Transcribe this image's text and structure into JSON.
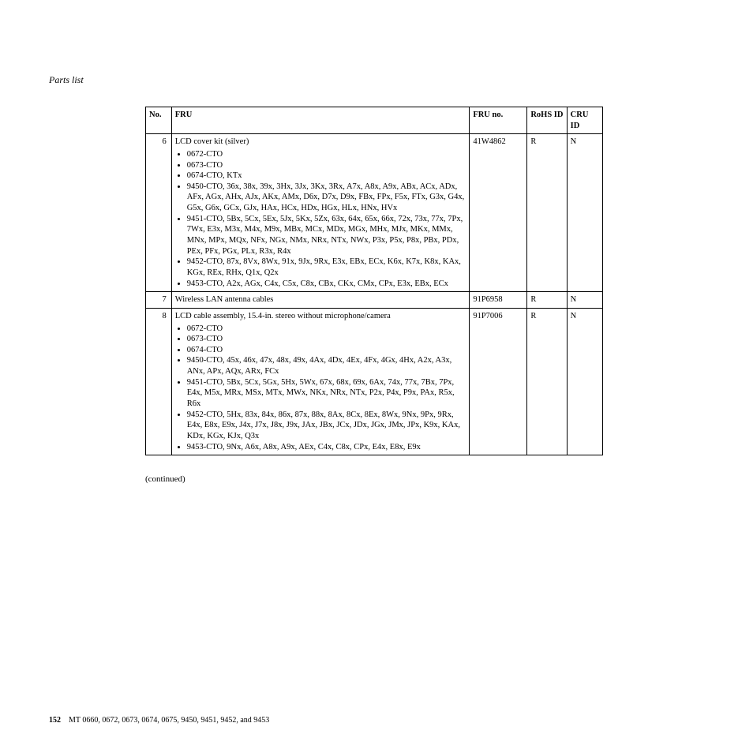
{
  "section_title": "Parts list",
  "headers": {
    "no": "No.",
    "fru": "FRU",
    "fru_no": "FRU no.",
    "rohs": "RoHS ID",
    "cru": "CRU ID"
  },
  "rows": [
    {
      "no": "6",
      "title": "LCD cover kit (silver)",
      "bullets": [
        "0672-CTO",
        "0673-CTO",
        "0674-CTO, KTx",
        "9450-CTO, 36x, 38x, 39x, 3Hx, 3Jx, 3Kx, 3Rx, A7x, A8x, A9x, ABx, ACx, ADx, AFx, AGx, AHx, AJx, AKx, AMx, D6x, D7x, D9x, FBx, FPx, F5x, FTx, G3x, G4x, G5x, G6x, GCx, GJx, HAx, HCx, HDx, HGx, HLx, HNx, HVx",
        "9451-CTO, 5Bx, 5Cx, 5Ex, 5Jx, 5Kx, 5Zx, 63x, 64x, 65x, 66x, 72x, 73x, 77x, 7Px, 7Wx, E3x, M3x, M4x, M9x, MBx, MCx, MDx, MGx, MHx, MJx, MKx, MMx, MNx, MPx, MQx, NFx, NGx, NMx, NRx, NTx, NWx, P3x, P5x, P8x, PBx, PDx, PEx, PFx, PGx, PLx, R3x, R4x",
        "9452-CTO, 87x, 8Vx, 8Wx, 91x, 9Jx, 9Rx, E3x, EBx, ECx, K6x, K7x, K8x, KAx, KGx, REx, RHx, Q1x, Q2x",
        "9453-CTO, A2x, AGx, C4x, C5x, C8x, CBx, CKx, CMx, CPx, E3x, EBx, ECx"
      ],
      "fru_no": "41W4862",
      "rohs": "R",
      "cru": "N"
    },
    {
      "no": "7",
      "title": "Wireless LAN antenna cables",
      "bullets": [],
      "fru_no": "91P6958",
      "rohs": "R",
      "cru": "N"
    },
    {
      "no": "8",
      "title": "LCD cable assembly, 15.4-in. stereo without microphone/camera",
      "bullets": [
        "0672-CTO",
        "0673-CTO",
        "0674-CTO",
        "9450-CTO, 45x, 46x, 47x, 48x, 49x, 4Ax, 4Dx, 4Ex, 4Fx, 4Gx, 4Hx, A2x, A3x, ANx, APx, AQx, ARx, FCx",
        "9451-CTO, 5Bx, 5Cx, 5Gx, 5Hx, 5Wx, 67x, 68x, 69x, 6Ax, 74x, 77x, 7Bx, 7Px, E4x, M5x, MRx, MSx, MTx, MWx, NKx, NRx, NTx, P2x, P4x, P9x, PAx, R5x, R6x",
        "9452-CTO, 5Hx, 83x, 84x, 86x, 87x, 88x, 8Ax, 8Cx, 8Ex, 8Wx, 9Nx, 9Px, 9Rx, E4x, E8x, E9x, J4x, J7x, J8x, J9x, JAx, JBx, JCx, JDx, JGx, JMx, JPx, K9x, KAx, KDx, KGx, KJx, Q3x",
        "9453-CTO, 9Nx, A6x, A8x, A9x, AEx, C4x, C8x, CPx, E4x, E8x, E9x"
      ],
      "fru_no": "91P7006",
      "rohs": "R",
      "cru": "N"
    }
  ],
  "continued": "(continued)",
  "footer": {
    "page": "152",
    "text": "MT 0660, 0672, 0673, 0674, 0675, 9450, 9451, 9452, and 9453"
  }
}
